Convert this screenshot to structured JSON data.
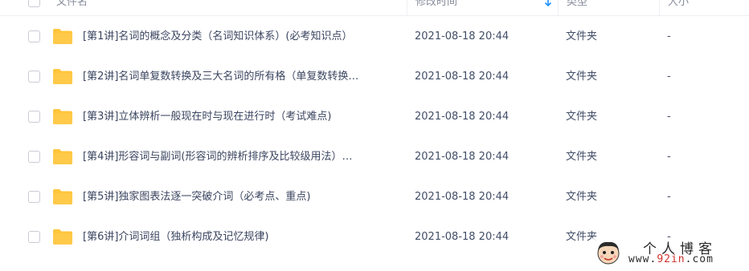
{
  "header": {
    "name_label": "文件名",
    "time_label": "修改时间",
    "type_label": "类型",
    "size_label": "大小",
    "sort_icon": "arrow-down-icon",
    "accent_color": "#1e90ff"
  },
  "files": [
    {
      "name": "[第1讲]名词的概念及分类（名词知识体系）(必考知识点）",
      "time": "2021-08-18 20:44",
      "type": "文件夹",
      "size": "-"
    },
    {
      "name": "[第2讲]名词单复数转换及三大名词的所有格（单复数转换…",
      "time": "2021-08-18 20:44",
      "type": "文件夹",
      "size": "-"
    },
    {
      "name": "[第3讲]立体辨析一般现在时与现在进行时（考试难点)",
      "time": "2021-08-18 20:44",
      "type": "文件夹",
      "size": "-"
    },
    {
      "name": "[第4讲]形容词与副词(形容词的辨析排序及比较级用法）…",
      "time": "2021-08-18 20:44",
      "type": "文件夹",
      "size": "-"
    },
    {
      "name": "[第5讲]独家图表法逐一突破介词（必考点、重点)",
      "time": "2021-08-18 20:44",
      "type": "文件夹",
      "size": "-"
    },
    {
      "name": "[第6讲]介词词组（独析构成及记忆规律)",
      "time": "2021-08-18 20:44",
      "type": "文件夹",
      "size": "-"
    }
  ],
  "folder_color": "#ffc53d",
  "watermark": {
    "title": "个人博客",
    "url_prefix": "www.",
    "url_accent": "92in",
    "url_suffix": ".com"
  }
}
